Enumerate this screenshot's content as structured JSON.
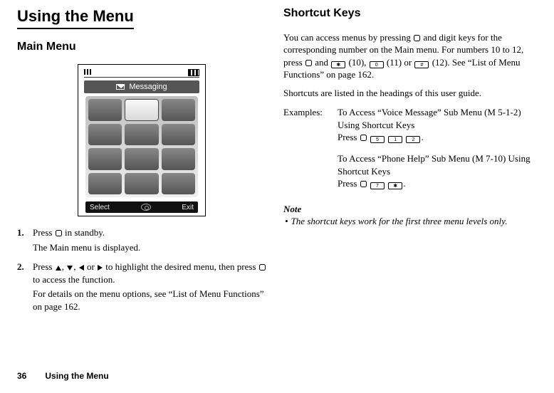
{
  "left": {
    "title": "Using the Menu",
    "subtitle": "Main Menu",
    "phone": {
      "menu_label": "Messaging",
      "softkey_left": "Select",
      "softkey_right": "Exit"
    },
    "step1_lead": "Press ",
    "step1_tail": " in standby.",
    "step1_sub": "The Main menu is displayed.",
    "step2_lead": "Press ",
    "step2_mid": " or ",
    "step2_tail1": " to highlight the desired menu, then press ",
    "step2_tail2": " to access the function.",
    "step2_sub": "For details on the menu options, see “List of Menu Functions” on page 162."
  },
  "right": {
    "title": "Shortcut Keys",
    "p1a": "You can access menus by pressing ",
    "p1b": " and digit keys for the corresponding number on the Main menu. For numbers 10 to 12, press ",
    "p1c": " and ",
    "p1d": " (10), ",
    "p1e": " (11) or ",
    "p1f": " (12). See “List of Menu Functions” on page 162.",
    "p2": "Shortcuts are listed in the headings of this user guide.",
    "examples_label": "Examples:",
    "ex1_line1": "To Access “Voice Message” Sub Menu (M 5-1-2) Using Shortcut Keys",
    "ex1_press": "Press ",
    "ex1_end": ".",
    "ex2_line1": "To Access “Phone Help” Sub Menu (M 7-10) Using Shortcut Keys",
    "ex2_press": "Press ",
    "ex2_end": ".",
    "note_head": "Note",
    "note_body": "The shortcut keys work for the first three menu levels only."
  },
  "keys": {
    "star": "✱",
    "zero": "0",
    "hash": "#",
    "five": "5",
    "one": "1",
    "two": "2",
    "seven": "7"
  },
  "footer": {
    "page_number": "36",
    "section": "Using the Menu"
  }
}
